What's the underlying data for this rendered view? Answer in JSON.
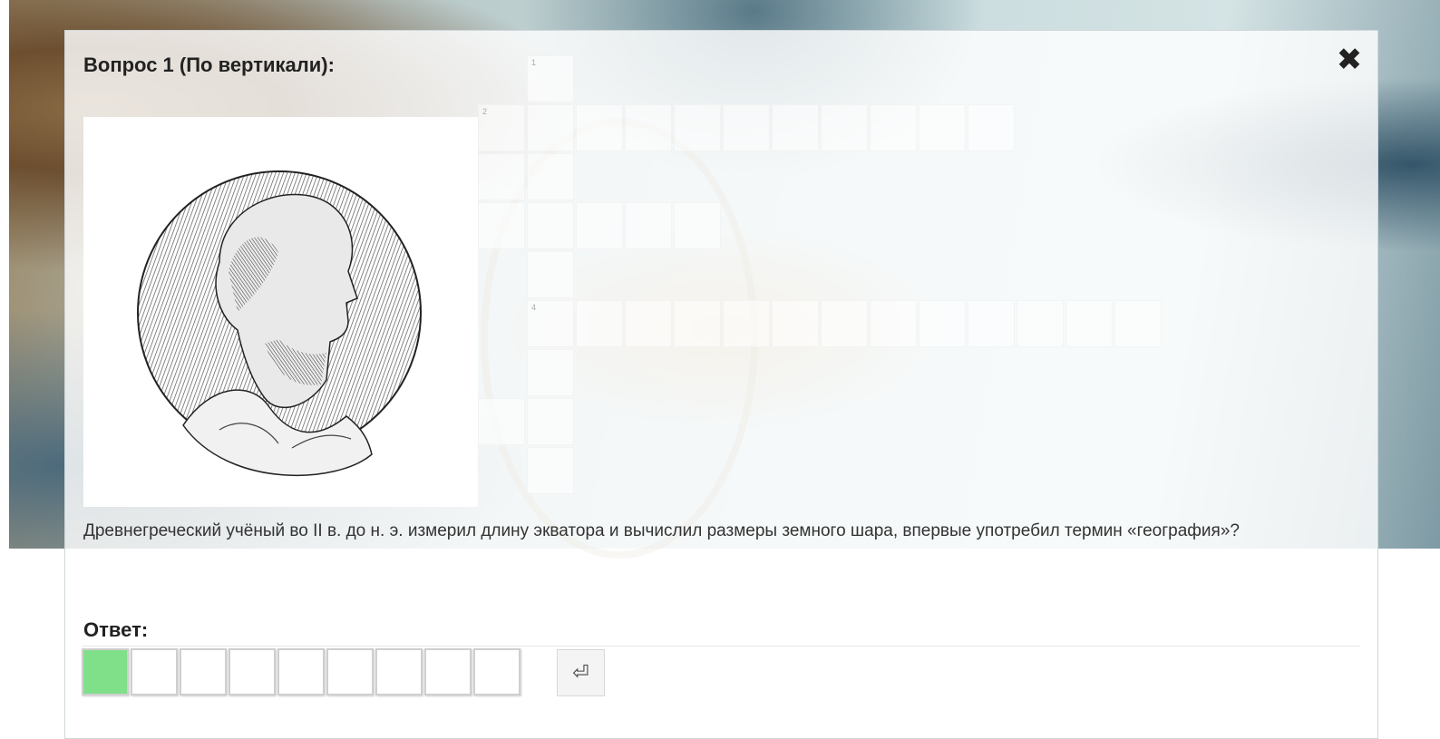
{
  "dialog": {
    "title": "Вопрос 1 (По вертикали):",
    "close_icon": "close-icon",
    "question_text": "Древнегреческий учёный во II в. до н. э. измерил длину экватора и вычислил размеры земного шара, впервые употребил термин «география»?",
    "answer_label": "Ответ:",
    "answer_length": 9,
    "enter_icon": "enter-icon",
    "enter_symbol": "⏎",
    "active_cell_color": "#80e08a"
  },
  "crossword": {
    "clue_numbers": [
      "1",
      "2",
      "4"
    ]
  },
  "portrait": {
    "icon": "portrait-engraving-image"
  }
}
